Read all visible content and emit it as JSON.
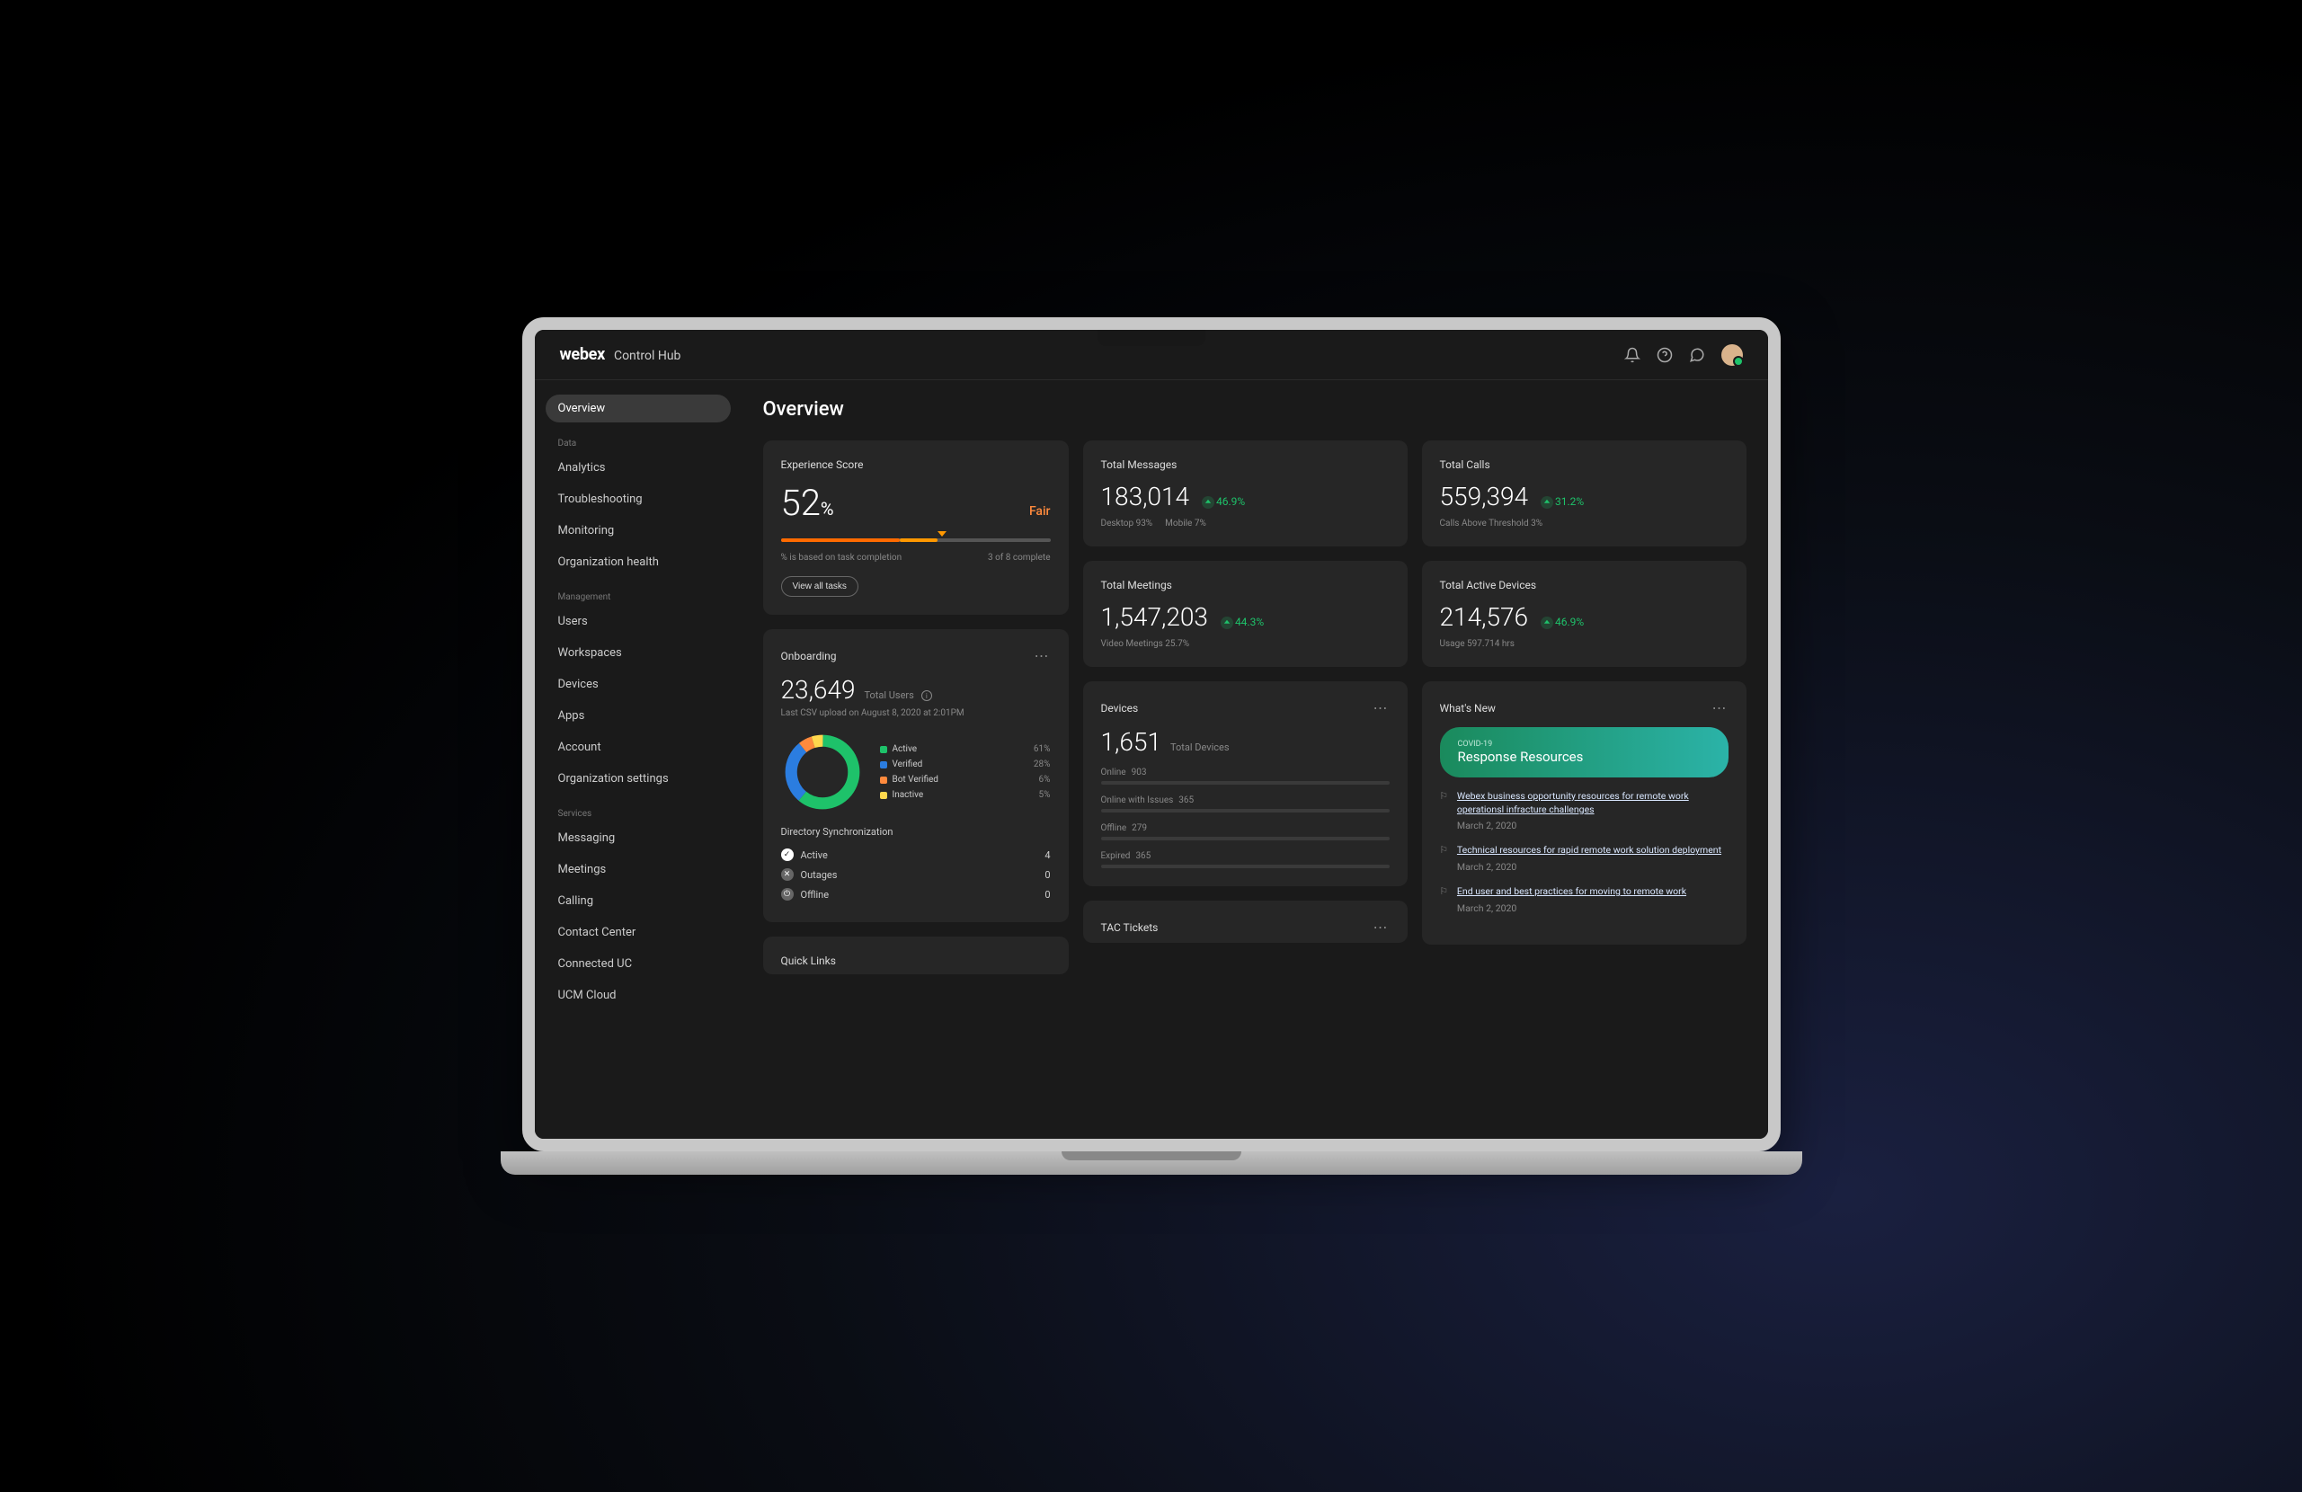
{
  "brand": {
    "logo": "webex",
    "sub": "Control Hub"
  },
  "sidebar": {
    "active": "Overview",
    "sections": [
      {
        "label": "",
        "items": [
          "Overview"
        ]
      },
      {
        "label": "Data",
        "items": [
          "Analytics",
          "Troubleshooting",
          "Monitoring",
          "Organization health"
        ]
      },
      {
        "label": "Management",
        "items": [
          "Users",
          "Workspaces",
          "Devices",
          "Apps",
          "Account",
          "Organization settings"
        ]
      },
      {
        "label": "Services",
        "items": [
          "Messaging",
          "Meetings",
          "Calling",
          "Contact Center",
          "Connected UC",
          "UCM Cloud"
        ]
      }
    ]
  },
  "page_title": "Overview",
  "experience": {
    "title": "Experience Score",
    "value": "52",
    "unit": "%",
    "rating": "Fair",
    "note_left": "% is based on task completion",
    "note_right": "3 of 8 complete",
    "button": "View all tasks"
  },
  "stats": {
    "messages": {
      "title": "Total Messages",
      "value": "183,014",
      "growth": "46.9%",
      "sub": [
        {
          "k": "Desktop",
          "v": "93%"
        },
        {
          "k": "Mobile",
          "v": "7%"
        }
      ]
    },
    "calls": {
      "title": "Total Calls",
      "value": "559,394",
      "growth": "31.2%",
      "sub": [
        {
          "k": "Calls Above Threshold",
          "v": "3%"
        }
      ]
    },
    "meetings": {
      "title": "Total Meetings",
      "value": "1,547,203",
      "growth": "44.3%",
      "sub": [
        {
          "k": "Video Meetings",
          "v": "25.7%"
        }
      ]
    },
    "devices": {
      "title": "Total Active Devices",
      "value": "214,576",
      "growth": "46.9%",
      "sub": [
        {
          "k": "Usage",
          "v": "597.714 hrs"
        }
      ]
    }
  },
  "onboarding": {
    "title": "Onboarding",
    "value": "23,649",
    "label": "Total Users",
    "csv": "Last CSV upload on August 8, 2020 at 2:01PM",
    "legend": [
      {
        "label": "Active",
        "pct": "61%",
        "color": "#1ec26a"
      },
      {
        "label": "Verified",
        "pct": "28%",
        "color": "#2b7de0"
      },
      {
        "label": "Bot Verified",
        "pct": "6%",
        "color": "#ff8a3d"
      },
      {
        "label": "Inactive",
        "pct": "5%",
        "color": "#ffd84d"
      }
    ],
    "dir_title": "Directory Synchronization",
    "dir": [
      {
        "label": "Active",
        "n": "4",
        "icon": "check"
      },
      {
        "label": "Outages",
        "n": "0",
        "icon": "x"
      },
      {
        "label": "Offline",
        "n": "0",
        "icon": "off"
      }
    ]
  },
  "devices_card": {
    "title": "Devices",
    "value": "1,651",
    "label": "Total Devices",
    "rows": [
      {
        "label": "Online",
        "n": "903",
        "segments": [
          {
            "w": 70,
            "c": "#1ec26a"
          }
        ]
      },
      {
        "label": "Online with Issues",
        "n": "365",
        "segments": [
          {
            "w": 14,
            "c": "#ff6a00"
          },
          {
            "w": 14,
            "c": "#ffd84d"
          }
        ]
      },
      {
        "label": "Offline",
        "n": "279",
        "segments": [
          {
            "w": 6,
            "c": "#ff3b5b"
          },
          {
            "w": 16,
            "c": "#fff"
          }
        ]
      },
      {
        "label": "Expired",
        "n": "365",
        "segments": [
          {
            "w": 28,
            "c": "#666"
          }
        ]
      }
    ]
  },
  "tac": {
    "title": "TAC Tickets"
  },
  "whats_new": {
    "title": "What's New",
    "banner": {
      "eyebrow": "COVID-19",
      "headline": "Response Resources"
    },
    "items": [
      {
        "link": "Webex business opportunity resources for remote work operationsl infracture challenges",
        "date": "March 2, 2020"
      },
      {
        "link": "Technical resources for rapid remote work solution deployment",
        "date": "March 2, 2020"
      },
      {
        "link": "End user and best practices for moving to remote work",
        "date": "March 2, 2020"
      }
    ]
  },
  "quick_links": {
    "title": "Quick Links"
  },
  "chart_data": {
    "type": "pie",
    "title": "Onboarding Users",
    "categories": [
      "Active",
      "Verified",
      "Bot Verified",
      "Inactive"
    ],
    "values": [
      61,
      28,
      6,
      5
    ],
    "colors": [
      "#1ec26a",
      "#2b7de0",
      "#ff8a3d",
      "#ffd84d"
    ]
  }
}
